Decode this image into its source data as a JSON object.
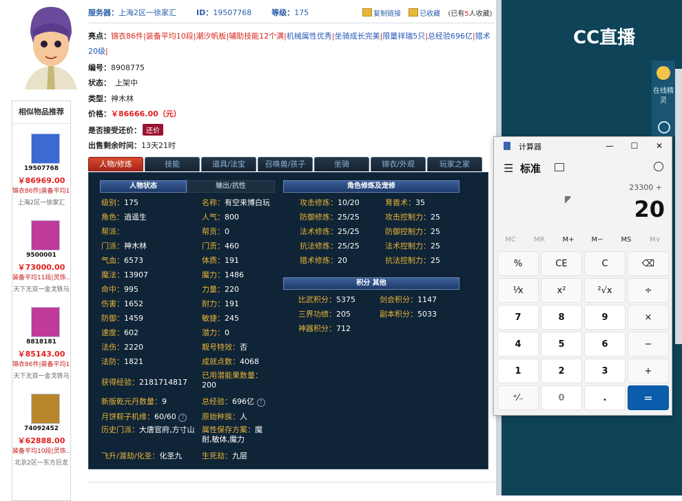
{
  "info": {
    "server_label": "服务器：",
    "server_value": "上海2区一徐家汇",
    "id_label": "ID：",
    "id_value": "19507768",
    "level_label": "等级：",
    "level_value": "175",
    "copy_link": "复制链接",
    "favorited": "已收藏",
    "fav_count_prefix": "(已有",
    "fav_count": "5",
    "fav_count_suffix": "人收藏)"
  },
  "highlights": {
    "label": "亮点：",
    "items": [
      "锦衣86件",
      "装备平均10段",
      "潮汐帆板",
      "辅助技能12个满",
      "机械属性优秀",
      "坐骑成长完美",
      "限量祥瑞5只",
      "总经验696亿",
      "猎术20级"
    ]
  },
  "details": {
    "serial_label": "编号：",
    "serial_value": "8908775",
    "status_label": "状态：",
    "status_value": "上架中",
    "type_label": "类型：",
    "type_value": "神木林",
    "price_label": "价格：",
    "price_value": "￥86666.00（元）",
    "counter_label": "是否接受还价：",
    "counter_button": "还价",
    "remaining_label": "出售剩余时间：",
    "remaining_value": "13天21时"
  },
  "similar": {
    "title": "相似物品推荐",
    "items": [
      {
        "id": "19507768",
        "price": "￥86969.00",
        "tags": "锦衣86件|装备平均1…",
        "server": "上海2区一徐家汇",
        "color": "#3b6ad0"
      },
      {
        "id": "9500001",
        "price": "￥73000.00",
        "tags": "装备平均11段|灵饰…",
        "server": "天下无双一金戈铁马",
        "color": "#c03a9a"
      },
      {
        "id": "8818181",
        "price": "￥85143.00",
        "tags": "锦衣86件|装备平均1…",
        "server": "天下无双一金戈铁马",
        "color": "#c03a9a"
      },
      {
        "id": "74092452",
        "price": "￥62888.00",
        "tags": "装备平均10段|灵饰…",
        "server": "北京2区一东方巨龙",
        "color": "#b8862a"
      }
    ]
  },
  "tabs": [
    "人物/修炼",
    "技能",
    "道具/法宝",
    "召唤兽/孩子",
    "坐骑",
    "锦衣/外观",
    "玩家之家"
  ],
  "panel": {
    "sec_role": "人物状态",
    "sec_output": "输出/抗性",
    "sec_cultivation": "角色修炼及宠修",
    "sec_points": "积分 其他",
    "col1": [
      {
        "k": "级别：",
        "v": "175"
      },
      {
        "k": "角色：",
        "v": "逍遥生"
      },
      {
        "k": "帮派：",
        "v": ""
      },
      {
        "k": "门派：",
        "v": "神木林"
      },
      {
        "k": "气血：",
        "v": "6573"
      },
      {
        "k": "魔法：",
        "v": "13907"
      },
      {
        "k": "命中：",
        "v": "995"
      },
      {
        "k": "伤害：",
        "v": "1652"
      },
      {
        "k": "防御：",
        "v": "1459"
      },
      {
        "k": "速度：",
        "v": "602"
      },
      {
        "k": "法伤：",
        "v": "2220"
      },
      {
        "k": "法防：",
        "v": "1821"
      }
    ],
    "col2": [
      {
        "k": "名称：",
        "v": "有空来博白玩"
      },
      {
        "k": "人气：",
        "v": "800"
      },
      {
        "k": "帮贡：",
        "v": "0"
      },
      {
        "k": "门贡：",
        "v": "460"
      },
      {
        "k": "体质：",
        "v": "191"
      },
      {
        "k": "魔力：",
        "v": "1486"
      },
      {
        "k": "力量：",
        "v": "220"
      },
      {
        "k": "耐力：",
        "v": "191"
      },
      {
        "k": "敏捷：",
        "v": "245"
      },
      {
        "k": "潜力：",
        "v": "0"
      },
      {
        "k": "靓号特效：",
        "v": "否"
      },
      {
        "k": "成就点数：",
        "v": "4068"
      }
    ],
    "extra": {
      "exp_k": "获得经验：",
      "exp_v": "2181714817",
      "used_k": "已用潜能果数量：",
      "used_v": "200",
      "qiankun_k": "新版乾元丹数量：",
      "qiankun_v": "9",
      "total_exp_k": "总经验：",
      "total_exp_v": "696亿",
      "zongzi_k": "月饼粽子机缘：",
      "zongzi_v": "60/60",
      "race_k": "原始种族：",
      "race_v": "人",
      "history_k": "历史门派：",
      "history_v": "大唐官府,方寸山",
      "attr_k": "属性保存方案：",
      "attr_v": "魔耐,敏体,魔力",
      "fly_k": "飞升/渡劫/化圣：",
      "fly_v": "化圣九",
      "death_k": "生死劫：",
      "death_v": "九层"
    },
    "cult_left": [
      {
        "k": "攻击修炼：",
        "v": "10/20"
      },
      {
        "k": "防御修炼：",
        "v": "25/25"
      },
      {
        "k": "法术修炼：",
        "v": "25/25"
      },
      {
        "k": "抗法修炼：",
        "v": "25/25"
      },
      {
        "k": "猎术修炼：",
        "v": "20"
      }
    ],
    "cult_right": [
      {
        "k": "育兽术：",
        "v": "35"
      },
      {
        "k": "攻击控制力：",
        "v": "25"
      },
      {
        "k": "防御控制力：",
        "v": "25"
      },
      {
        "k": "法术控制力：",
        "v": "25"
      },
      {
        "k": "抗法控制力：",
        "v": "25"
      }
    ],
    "points_left": [
      {
        "k": "比武积分：",
        "v": "5375"
      },
      {
        "k": "三界功绩：",
        "v": "205"
      },
      {
        "k": "神器积分：",
        "v": "712"
      }
    ],
    "points_right": [
      {
        "k": "剑会积分：",
        "v": "1147"
      },
      {
        "k": "副本积分：",
        "v": "5033"
      }
    ]
  },
  "cc": {
    "logo": "CC直播",
    "side_label": "在线精灵"
  },
  "calc": {
    "title": "计算器",
    "mode": "标准",
    "expression": "23300 +",
    "display": "20",
    "memory": [
      "MC",
      "MR",
      "M+",
      "M−",
      "MS",
      "M∨"
    ],
    "keys": [
      [
        "%",
        "CE",
        "C",
        "⌫"
      ],
      [
        "¹⁄x",
        "x²",
        "²√x",
        "÷"
      ],
      [
        "7",
        "8",
        "9",
        "×"
      ],
      [
        "4",
        "5",
        "6",
        "−"
      ],
      [
        "1",
        "2",
        "3",
        "+"
      ],
      [
        "⁺⁄₋",
        "0",
        ".",
        "="
      ]
    ]
  }
}
